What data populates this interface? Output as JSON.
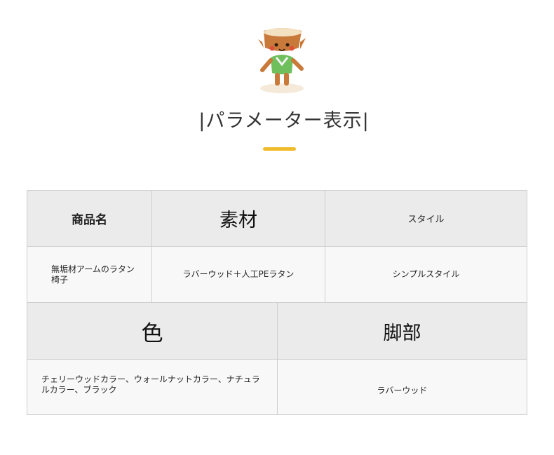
{
  "title": "|パラメーター表示|",
  "table": {
    "row1_headers": [
      "商品名",
      "素材",
      "スタイル"
    ],
    "row1_values": [
      "無垢材アームのラタン椅子",
      "ラバーウッド＋人工PEラタン",
      "シンプルスタイル"
    ],
    "row2_headers": [
      "色",
      "脚部"
    ],
    "row2_values": [
      "チェリーウッドカラー、ウォールナットカラー、ナチュラルカラー、ブラック",
      "ラバーウッド"
    ]
  },
  "colors": {
    "accent": "#f0bb2c",
    "header_bg": "#ebebeb",
    "cell_bg": "#f8f8f8",
    "border": "#cfcfcf"
  }
}
